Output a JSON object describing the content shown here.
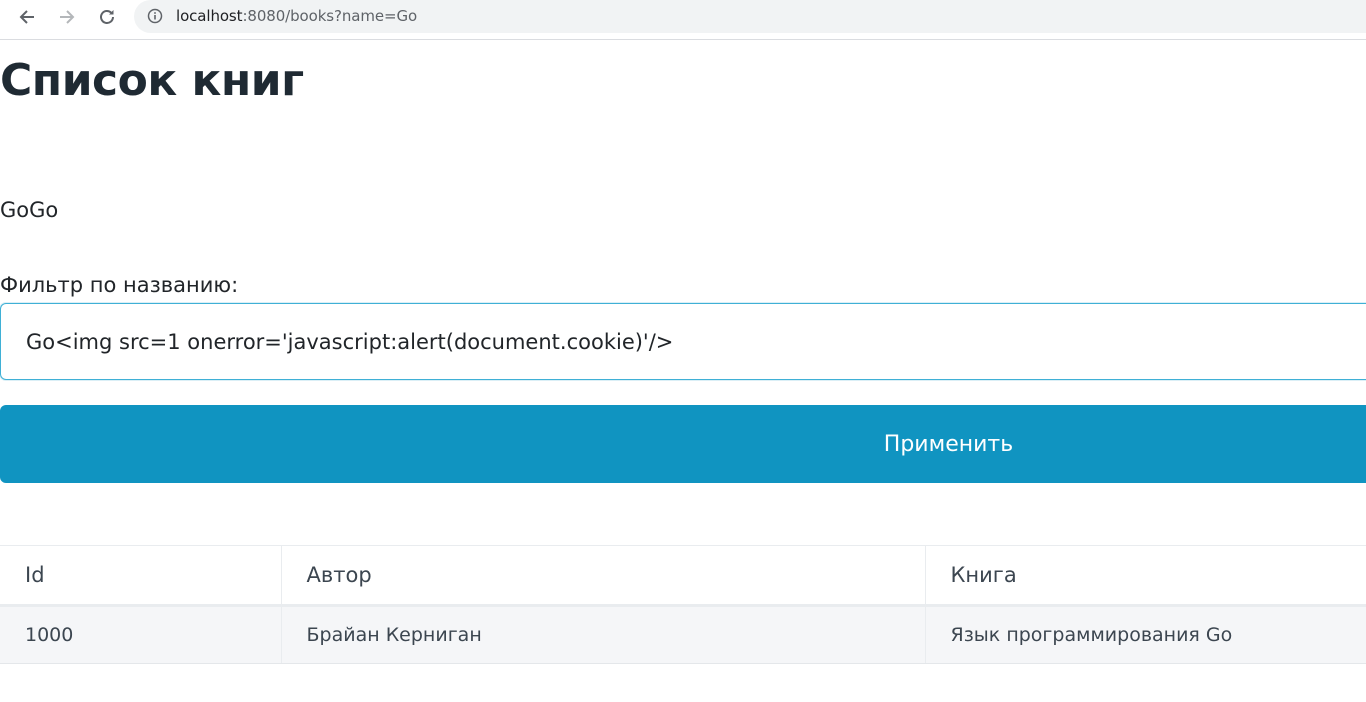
{
  "browser": {
    "url_host": "localhost",
    "url_rest": ":8080/books?name=Go"
  },
  "page": {
    "title": "Список книг",
    "echo_text": "GoGo",
    "filter_label": "Фильтр по названию:",
    "filter_value": "Go<img src=1 onerror='javascript:alert(document.cookie)'/>",
    "apply_label": "Применить"
  },
  "table": {
    "headers": [
      "Id",
      "Автор",
      "Книга"
    ],
    "rows": [
      [
        "1000",
        "Брайан Керниган",
        "Язык программирования Go"
      ]
    ]
  },
  "colors": {
    "accent": "#1094c1",
    "title": "#1f2a33",
    "row_background": "#f5f6f8"
  },
  "icons": [
    "back-arrow-icon",
    "forward-arrow-icon",
    "reload-icon",
    "info-icon"
  ]
}
